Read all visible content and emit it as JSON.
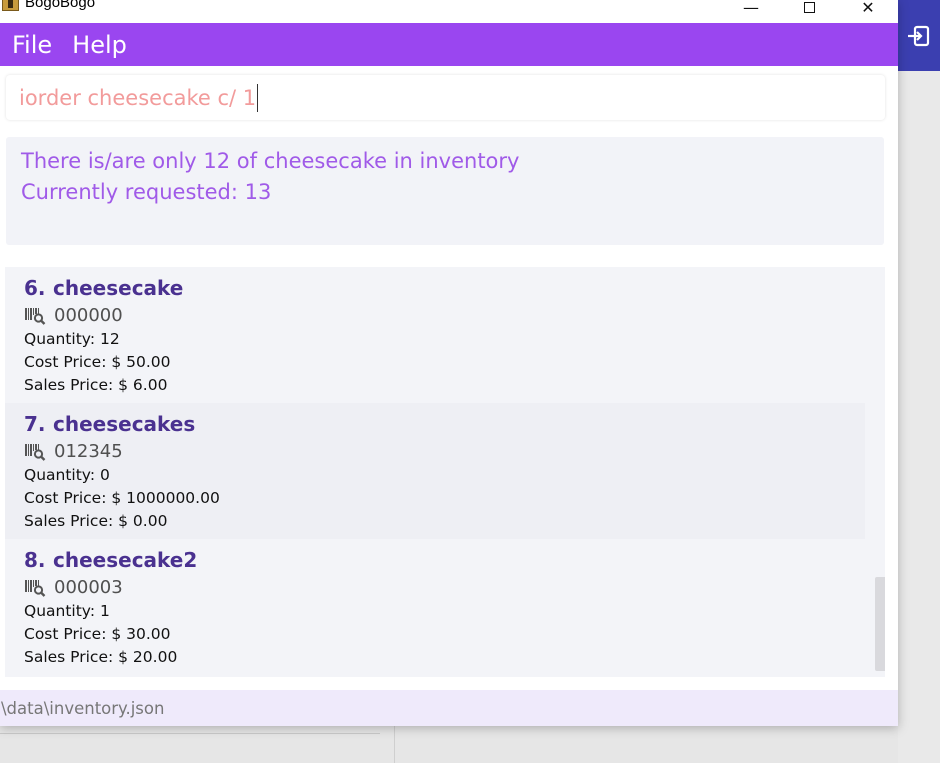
{
  "window": {
    "title": "BogoBogo",
    "minimize_glyph": "—",
    "close_glyph": "✕"
  },
  "menu": {
    "file_label": "File",
    "help_label": "Help"
  },
  "command": {
    "value": "iorder cheesecake c/ 1"
  },
  "result": {
    "line1": "There is/are only 12 of cheesecake in inventory",
    "line2": "Currently requested: 13"
  },
  "items": [
    {
      "index": "6.",
      "name": "cheesecake",
      "sku": "000000",
      "quantity": "Quantity: 12",
      "cost": "Cost Price: $ 50.00",
      "sales": "Sales Price: $ 6.00"
    },
    {
      "index": "7.",
      "name": "cheesecakes",
      "sku": "012345",
      "quantity": "Quantity: 0",
      "cost": "Cost Price: $ 1000000.00",
      "sales": "Sales Price: $ 0.00"
    },
    {
      "index": "8.",
      "name": "cheesecake2",
      "sku": "000003",
      "quantity": "Quantity: 1",
      "cost": "Cost Price: $ 30.00",
      "sales": "Sales Price: $ 20.00"
    }
  ],
  "status": {
    "path": "\\data\\inventory.json"
  },
  "icons": {
    "barcode": "barcode-search-icon",
    "exit": "sign-in-icon"
  },
  "colors": {
    "menu_bar": "#9a46f0",
    "command_text": "#f29b9b",
    "result_text": "#a05ae8",
    "item_title": "#4a3190",
    "background_tab": "#3b3fb0"
  }
}
